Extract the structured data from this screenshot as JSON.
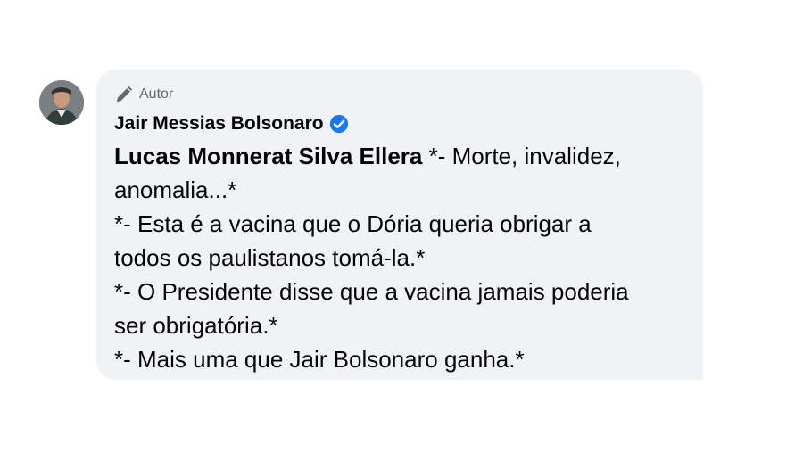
{
  "comment": {
    "badge_label": "Autor",
    "author_name": "Jair Messias Bolsonaro",
    "mention": "Lucas Monnerat Silva Ellera",
    "lines": [
      " *- Morte, invalidez,",
      "anomalia...*",
      "*- Esta é a vacina que o Dória queria obrigar a",
      "todos os paulistanos tomá-la.*",
      "*- O Presidente disse que a vacina jamais poderia",
      "ser obrigatória.*",
      "*- Mais uma que Jair Bolsonaro ganha.*"
    ],
    "icons": {
      "badge": "pencil-icon",
      "verified": "verified-badge-icon",
      "verified_color": "#1877f2"
    }
  }
}
